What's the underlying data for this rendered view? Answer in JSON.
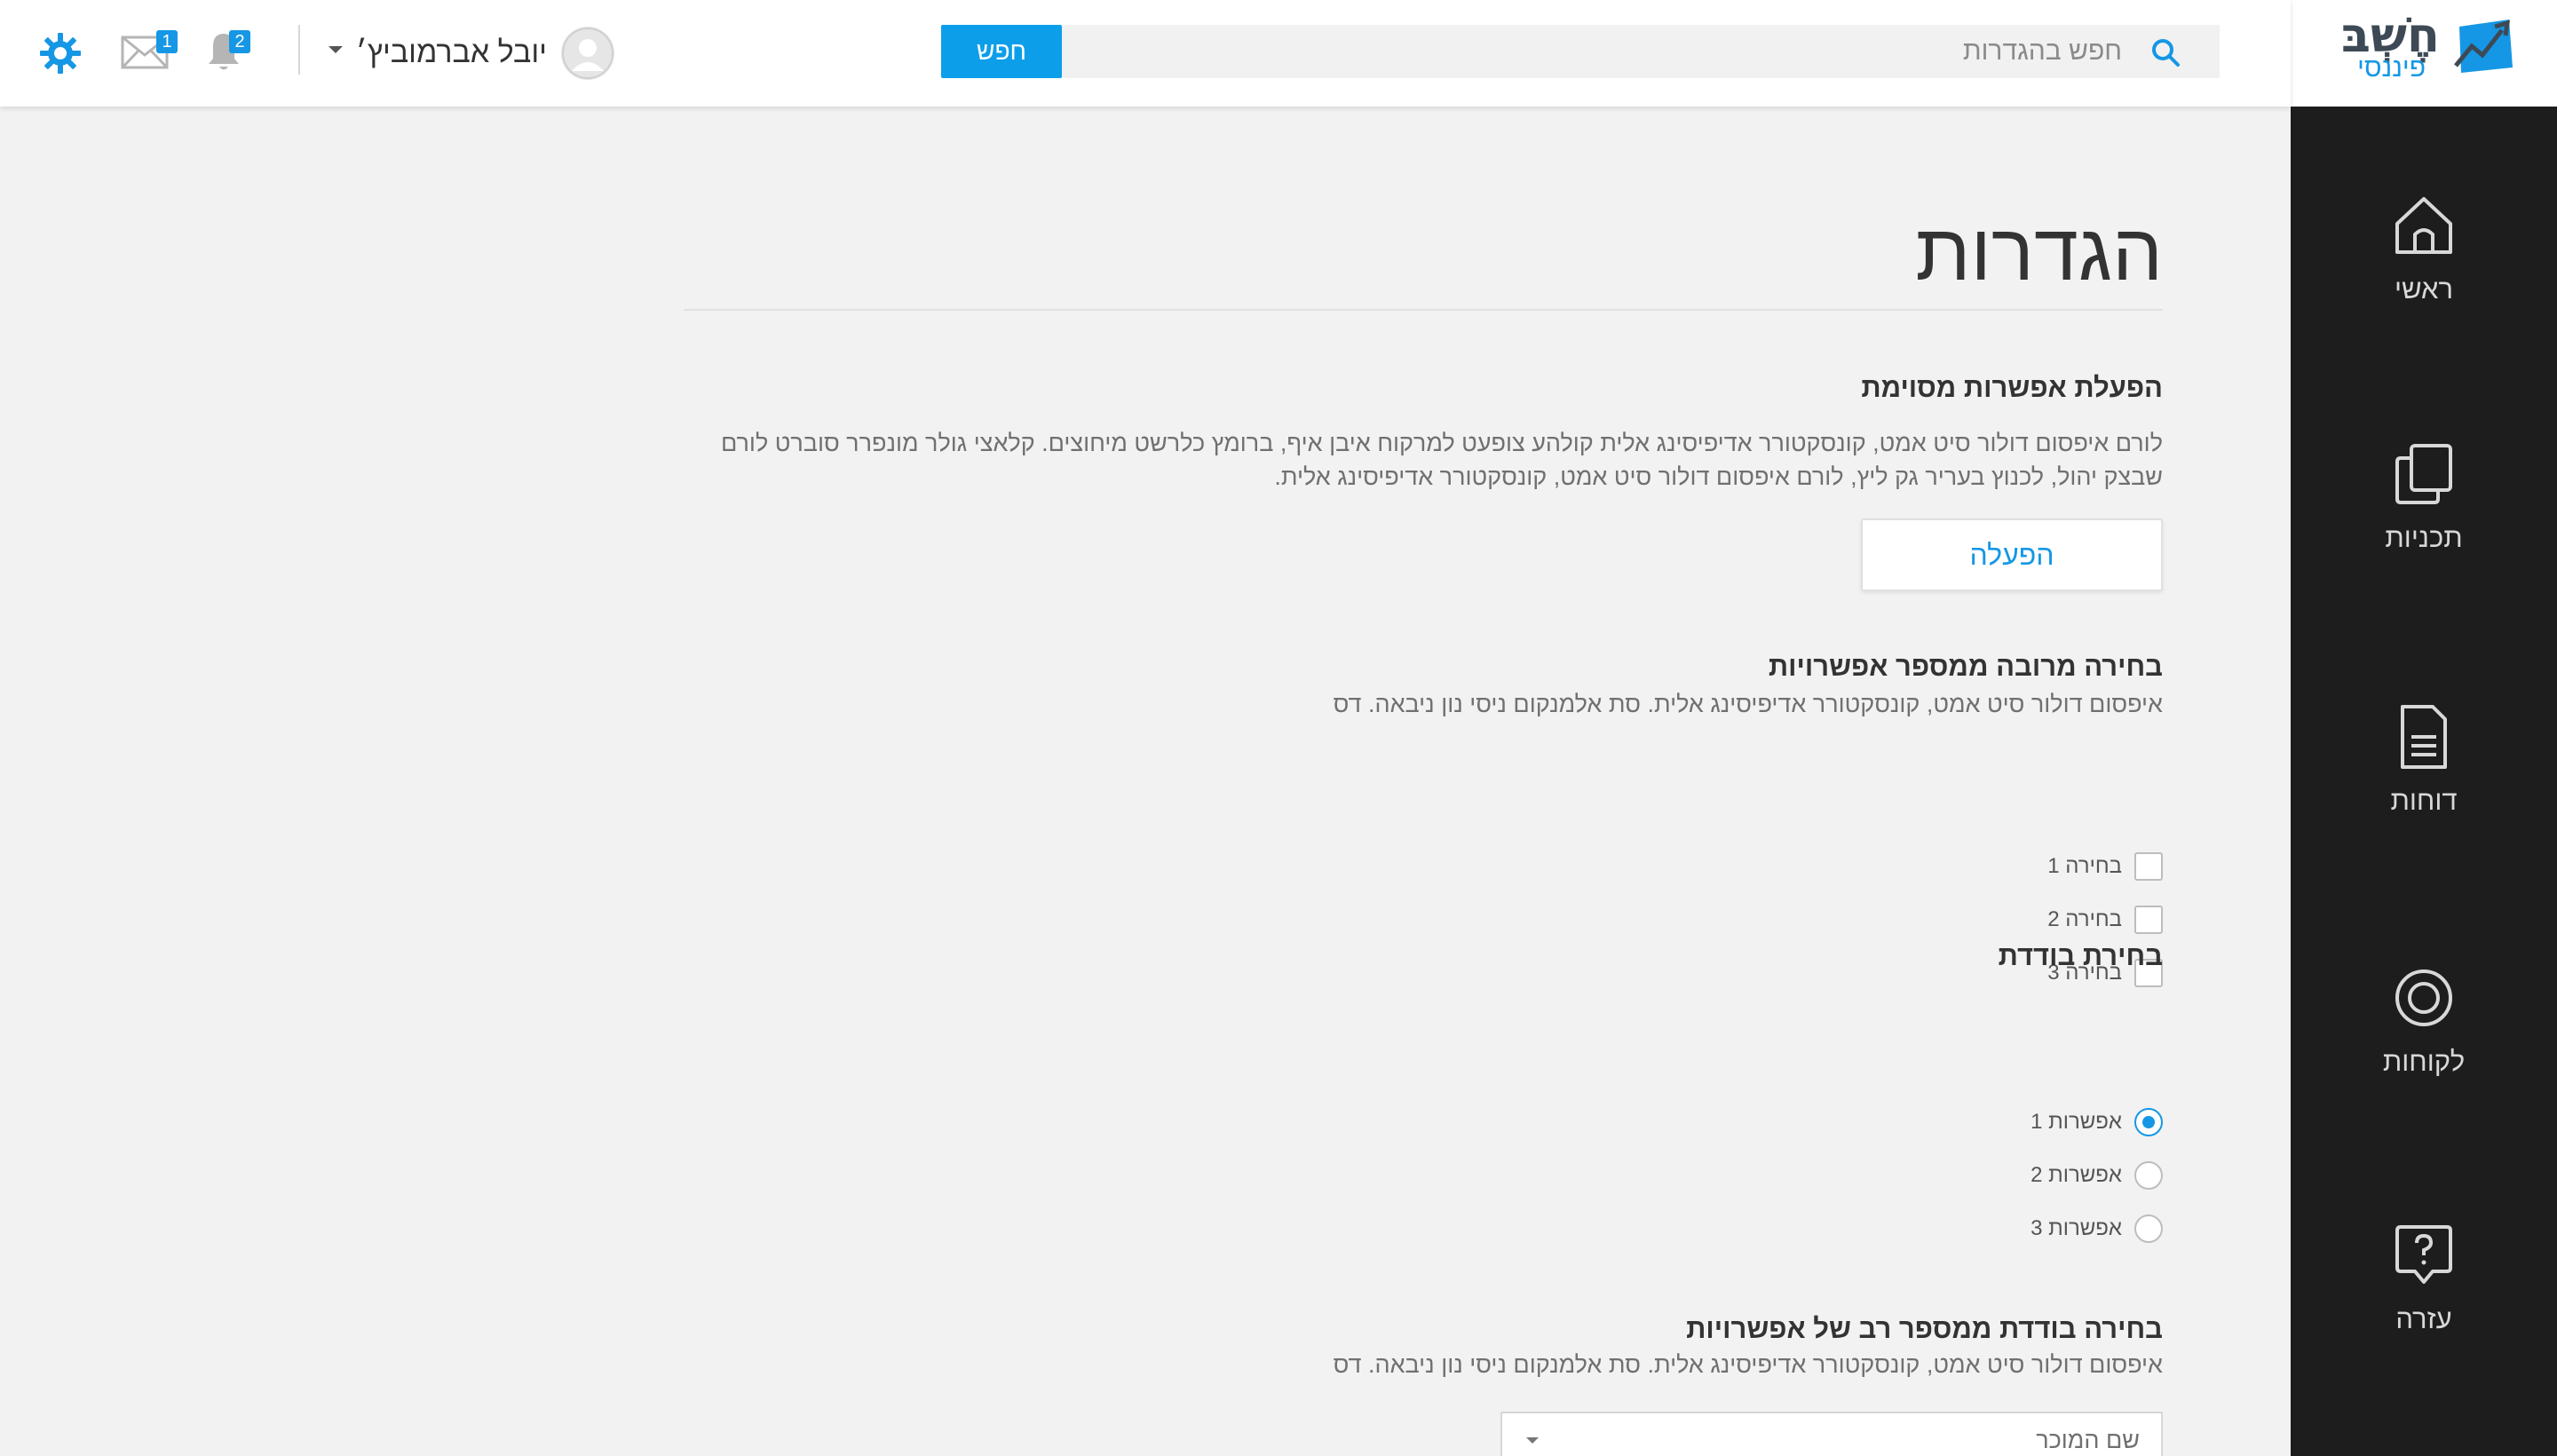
{
  "brand": {
    "name": "חֶשְׁבּ",
    "sub": "פיננסי",
    "colors": {
      "accent": "#1597e5",
      "dark": "#3d4a55",
      "sidebar": "#1d1d1d"
    }
  },
  "sidebar": {
    "items": [
      {
        "label": "ראשי",
        "icon": "home-icon"
      },
      {
        "label": "תכניות",
        "icon": "copy-icon"
      },
      {
        "label": "דוחות",
        "icon": "document-icon"
      },
      {
        "label": "לקוחות",
        "icon": "target-icon"
      },
      {
        "label": "עזרה",
        "icon": "help-icon"
      }
    ]
  },
  "header": {
    "search_placeholder": "חפש בהגדרות",
    "search_button": "חפש",
    "user_name": "יובל אברמוביץ׳",
    "notifications_count": "2",
    "messages_count": "1"
  },
  "page": {
    "title": "הגדרות",
    "sections": [
      {
        "title": "הפעלת אפשרות מסוימת",
        "description": "לורם איפסום דולור סיט אמט, קונסקטורר אדיפיסינג אלית קולהע צופעט למרקוח איבן איף, ברומץ כלרשט מיחוצים. קלאצי גולר מונפרר סוברט לורם שבצק יהול, לכנוץ בעריר גק ליץ, לורם איפסום דולור סיט אמט, קונסקטורר אדיפיסינג אלית.",
        "button": "הפעלה"
      },
      {
        "title": "בחירה מרובה ממספר אפשרויות",
        "description": "איפסום דולור סיט אמט, קונסקטורר אדיפיסינג אלית. סת אלמנקום ניסי נון ניבאה. דס",
        "options": [
          "בחירה 1",
          "בחירה 2",
          "בחירה 3"
        ]
      },
      {
        "title": "בחירת בודדת",
        "options": [
          "אפשרות 1",
          "אפשרות 2",
          "אפשרות 3"
        ],
        "selected": "אפשרות 1"
      },
      {
        "title": "בחירה בודדת ממספר רב של אפשרויות",
        "description": "איפסום דולור סיט אמט, קונסקטורר אדיפיסינג אלית. סת אלמנקום ניסי נון ניבאה. דס",
        "select_placeholder": "שם המוכר"
      }
    ]
  }
}
